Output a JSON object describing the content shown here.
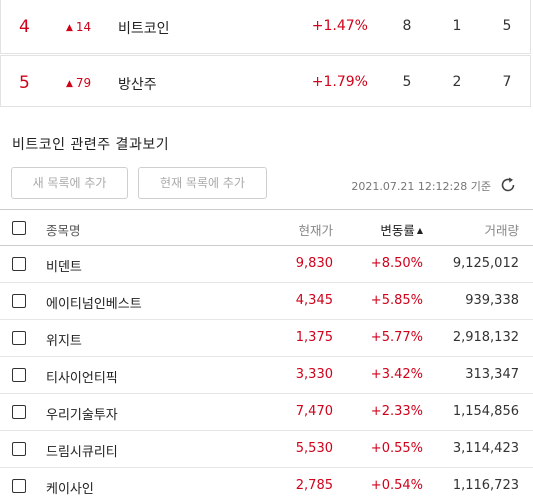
{
  "ranking": [
    {
      "rank": "4",
      "change": "14",
      "name": "비트코인",
      "pct": "+1.47%",
      "c1": "8",
      "c2": "1",
      "c3": "5"
    },
    {
      "rank": "5",
      "change": "79",
      "name": "방산주",
      "pct": "+1.79%",
      "c1": "5",
      "c2": "2",
      "c3": "7"
    }
  ],
  "section": {
    "title": "비트코인 관련주 결과보기"
  },
  "buttons": {
    "new_list": "새 목록에 추가",
    "current_list": "현재 목록에 추가"
  },
  "timestamp": "2021.07.21 12:12:28 기준",
  "table": {
    "headers": {
      "name": "종목명",
      "price": "현재가",
      "change": "변동률",
      "volume": "거래량"
    },
    "rows": [
      {
        "name": "비덴트",
        "price": "9,830",
        "change": "+8.50%",
        "volume": "9,125,012"
      },
      {
        "name": "에이티넘인베스트",
        "price": "4,345",
        "change": "+5.85%",
        "volume": "939,338"
      },
      {
        "name": "위지트",
        "price": "1,375",
        "change": "+5.77%",
        "volume": "2,918,132"
      },
      {
        "name": "티사이언티픽",
        "price": "3,330",
        "change": "+3.42%",
        "volume": "313,347"
      },
      {
        "name": "우리기술투자",
        "price": "7,470",
        "change": "+2.33%",
        "volume": "1,154,856"
      },
      {
        "name": "드림시큐리티",
        "price": "5,530",
        "change": "+0.55%",
        "volume": "3,114,423"
      },
      {
        "name": "케이사인",
        "price": "2,785",
        "change": "+0.54%",
        "volume": "1,116,723"
      }
    ]
  },
  "colors": {
    "up": "#d0021b",
    "border": "#e2e2e2"
  },
  "icons": {
    "up_arrow": "triangle-up-icon",
    "refresh": "refresh-icon",
    "sort": "sort-up-icon"
  }
}
